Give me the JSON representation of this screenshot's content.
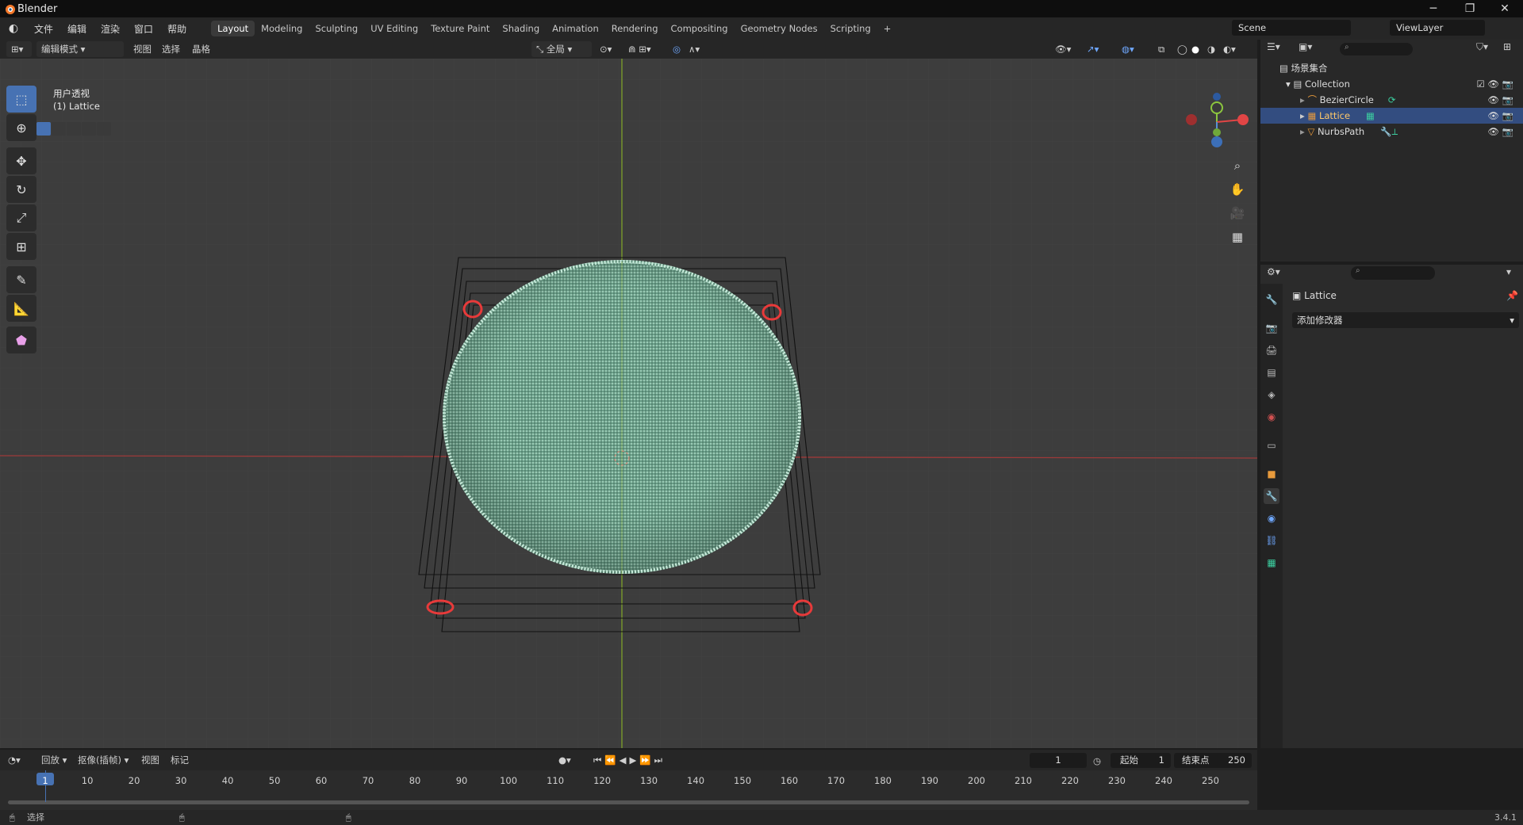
{
  "window": {
    "title": "Blender",
    "minimize": "─",
    "maximize": "❐",
    "close": "✕"
  },
  "menus": [
    "文件",
    "编辑",
    "渲染",
    "窗口",
    "帮助"
  ],
  "workspaces": [
    "Layout",
    "Modeling",
    "Sculpting",
    "UV Editing",
    "Texture Paint",
    "Shading",
    "Animation",
    "Rendering",
    "Compositing",
    "Geometry Nodes",
    "Scripting",
    "+"
  ],
  "active_workspace": "Layout",
  "scene": {
    "name": "Scene",
    "view_layer": "ViewLayer"
  },
  "viewport_header": {
    "mode": "编辑模式",
    "menus": [
      "视图",
      "选择",
      "晶格"
    ],
    "orientation": "全局"
  },
  "viewport": {
    "view_name": "用户透视",
    "object_label": "(1) Lattice"
  },
  "outliner": {
    "root": "场景集合",
    "collection": "Collection",
    "items": [
      {
        "name": "BezierCircle",
        "selected": false,
        "color": "#e89a3c"
      },
      {
        "name": "Lattice",
        "selected": true,
        "color": "#e89a3c"
      },
      {
        "name": "NurbsPath",
        "selected": false,
        "color": "#e89a3c"
      }
    ]
  },
  "properties": {
    "object_name": "Lattice",
    "add_modifier": "添加修改器"
  },
  "timeline": {
    "menus": [
      "回放",
      "抠像(插帧)",
      "视图",
      "标记"
    ],
    "current_frame": "1",
    "start_label": "起始",
    "start": "1",
    "end_label": "结束点",
    "end": "250",
    "ticks": [
      "1",
      "10",
      "20",
      "30",
      "40",
      "50",
      "60",
      "70",
      "80",
      "90",
      "100",
      "110",
      "120",
      "130",
      "140",
      "150",
      "160",
      "170",
      "180",
      "190",
      "200",
      "210",
      "220",
      "230",
      "240",
      "250"
    ]
  },
  "status": {
    "left": "选择",
    "version": "3.4.1"
  },
  "colors": {
    "accent": "#4772b3",
    "mesh": "#7fbfa4",
    "highlight": "#e83a3a"
  }
}
